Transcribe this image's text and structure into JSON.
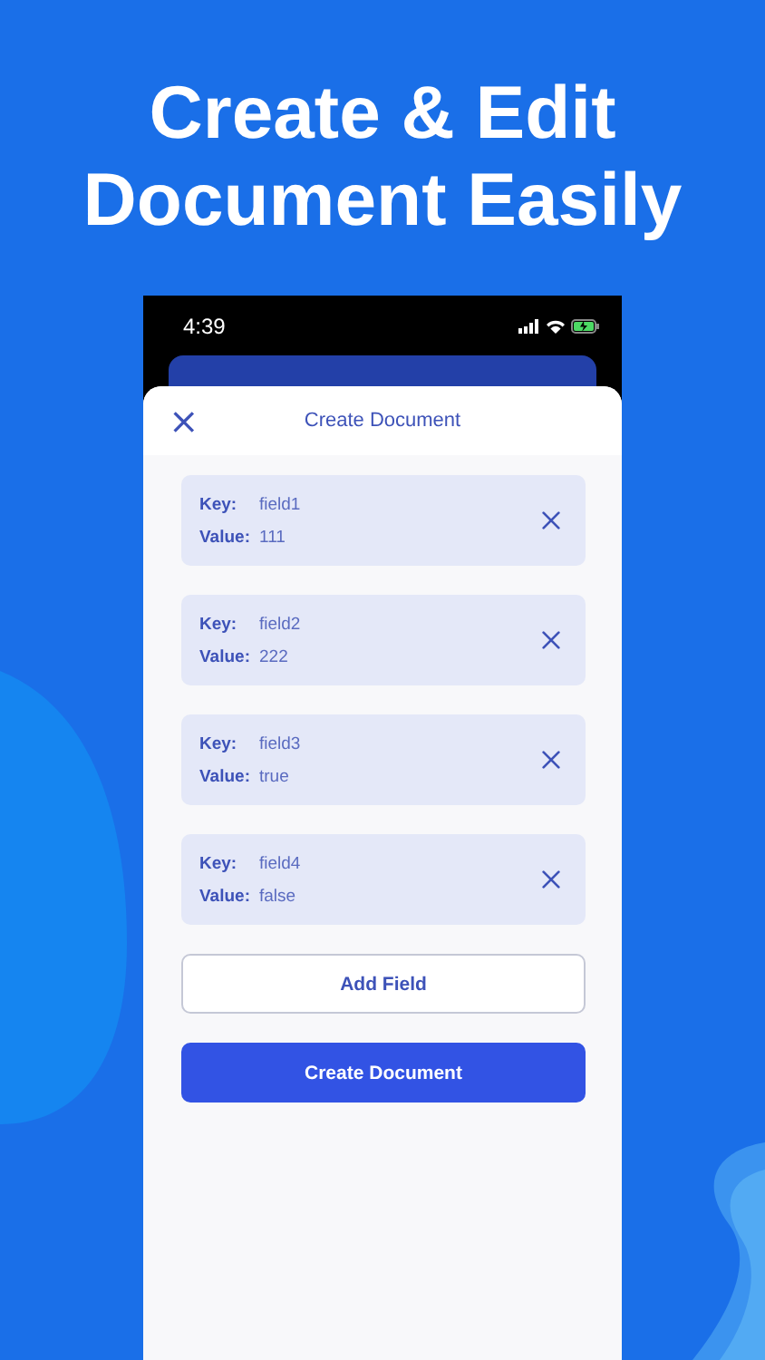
{
  "headline": [
    "Create & Edit",
    "Document Easily"
  ],
  "status_bar": {
    "time": "4:39"
  },
  "sheet": {
    "title": "Create Document",
    "close": "×"
  },
  "fields": [
    {
      "key_label": "Key:",
      "key": "field1",
      "value_label": "Value:",
      "value": "111"
    },
    {
      "key_label": "Key:",
      "key": "field2",
      "value_label": "Value:",
      "value": "222"
    },
    {
      "key_label": "Key:",
      "key": "field3",
      "value_label": "Value:",
      "value": "true"
    },
    {
      "key_label": "Key:",
      "key": "field4",
      "value_label": "Value:",
      "value": "false"
    }
  ],
  "buttons": [
    {
      "label": "Add Field",
      "kind": "outline"
    },
    {
      "label": "Create Document",
      "kind": "primary"
    }
  ]
}
